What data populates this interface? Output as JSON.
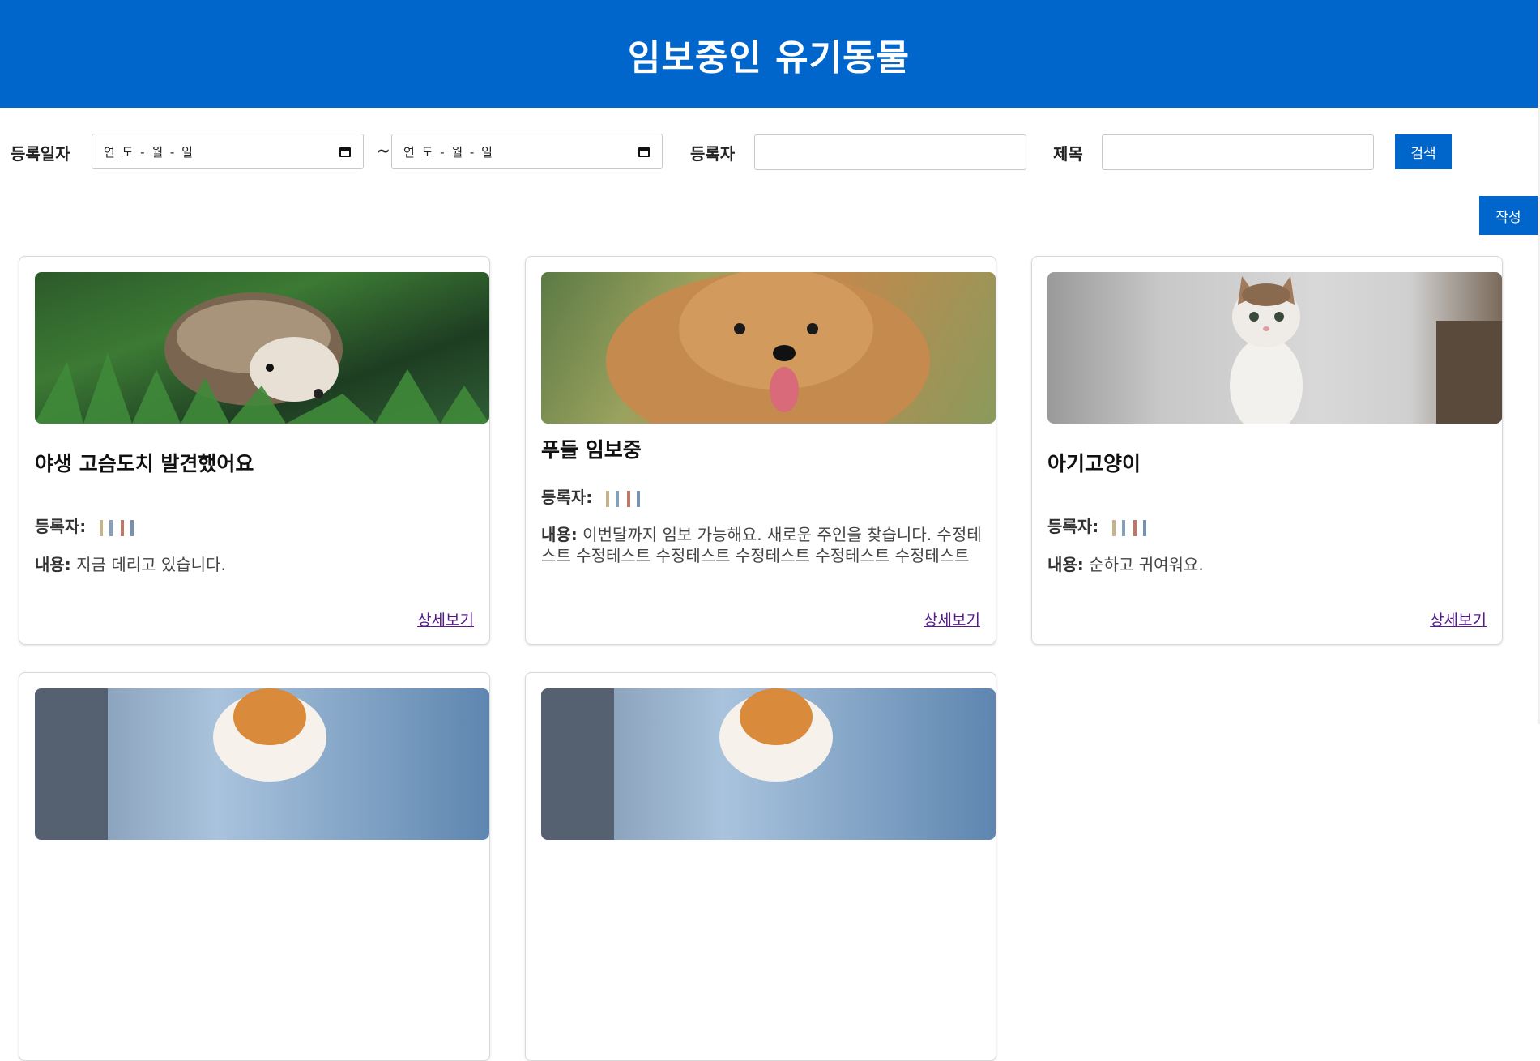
{
  "header": {
    "title": "임보중인 유기동물"
  },
  "search": {
    "date_label": "등록일자",
    "date_from_placeholder": "연 도 - 월 - 일",
    "date_separator": "~",
    "date_to_placeholder": "연 도 - 월 - 일",
    "author_label": "등록자",
    "author_value": "",
    "title_label": "제목",
    "title_value": "",
    "search_button": "검색"
  },
  "write_button": "작성",
  "cards": [
    {
      "title": "야생 고슴도치 발견했어요",
      "author_label": "등록자:",
      "content_label": "내용:",
      "content": "지금 데리고 있습니다.",
      "link": "상세보기",
      "image": "hedgehog-photo"
    },
    {
      "title": "푸들 임보중",
      "author_label": "등록자:",
      "content_label": "내용:",
      "content": "이번달까지 임보 가능해요. 새로운 주인을 찾습니다. 수정테스트 수정테스트 수정테스트 수정테스트 수정테스트 수정테스트",
      "link": "상세보기",
      "image": "poodle-photo"
    },
    {
      "title": "아기고양이",
      "author_label": "등록자:",
      "content_label": "내용:",
      "content": "순하고 귀여워요.",
      "link": "상세보기",
      "image": "kitten-photo"
    },
    {
      "image": "pomeranian-photo"
    },
    {
      "image": "pomeranian-photo"
    }
  ],
  "colors": {
    "brand": "#0066cc",
    "link": "#551a8b"
  }
}
